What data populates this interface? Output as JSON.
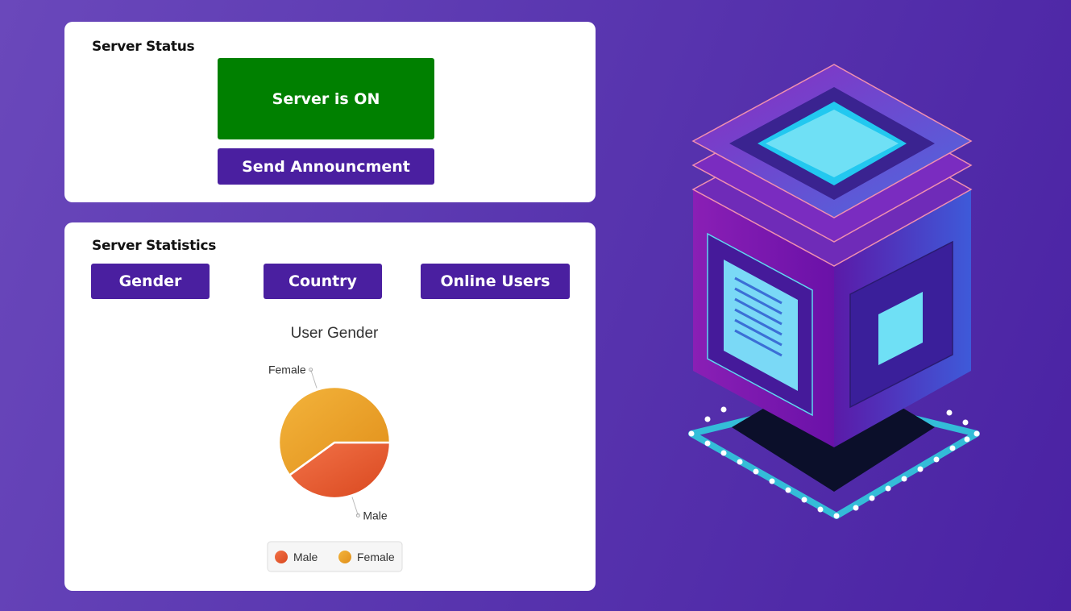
{
  "status_card": {
    "title": "Server Status",
    "server_button_label": "Server is ON",
    "announce_button_label": "Send Announcment"
  },
  "stats_card": {
    "title": "Server Statistics",
    "tabs": [
      {
        "label": "Gender"
      },
      {
        "label": "Country"
      },
      {
        "label": "Online Users"
      }
    ]
  },
  "chart_data": {
    "type": "pie",
    "title": "User Gender",
    "slices": [
      {
        "label": "Male",
        "value": 40,
        "color": "#e45a2e"
      },
      {
        "label": "Female",
        "value": 60,
        "color": "#f0a030"
      }
    ],
    "legend": [
      "Male",
      "Female"
    ],
    "legend_position": "bottom-center"
  },
  "colors": {
    "server_on": "#008000",
    "primary": "#4a1fa0",
    "card_bg": "#ffffff"
  },
  "illustration": {
    "icon": "server-cube-illustration"
  }
}
